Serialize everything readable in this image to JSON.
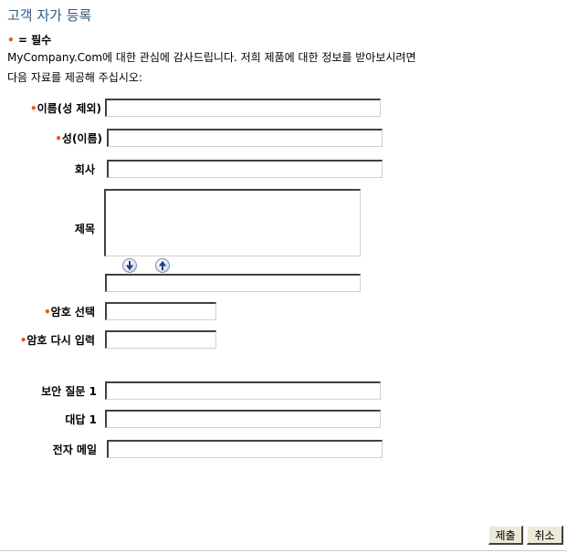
{
  "title": "고객 자가 등록",
  "required_note": {
    "bullet": "•",
    "text": "= 필수"
  },
  "intro": {
    "line1": "MyCompany.Com에 대한 관심에 감사드립니다. 저희 제품에 대한 정보를 받아보시려면",
    "line2": "다음 자료를 제공해 주십시오:"
  },
  "fields": {
    "first_name": {
      "label": "이름(성 제외)",
      "required": true,
      "value": ""
    },
    "last_name": {
      "label": "성(이름)",
      "required": true,
      "value": ""
    },
    "company": {
      "label": "회사",
      "required": false,
      "value": ""
    },
    "subject": {
      "label": "제목",
      "required": false,
      "value": ""
    },
    "password": {
      "label": "암호 선택",
      "required": true,
      "value": ""
    },
    "password_confirm": {
      "label": "암호 다시 입력",
      "required": true,
      "value": ""
    },
    "security_question": {
      "label": "보안 질문 1",
      "required": false,
      "value": ""
    },
    "answer": {
      "label": "대답 1",
      "required": false,
      "value": ""
    },
    "email": {
      "label": "전자 메일",
      "required": false,
      "value": ""
    }
  },
  "buttons": {
    "submit": "제출",
    "cancel": "취소"
  },
  "icons": {
    "move_down": "arrow-down-circle-icon",
    "move_up": "arrow-up-circle-icon"
  },
  "colors": {
    "title": "#2d5a83",
    "required_bullet": "#e85d0c"
  }
}
